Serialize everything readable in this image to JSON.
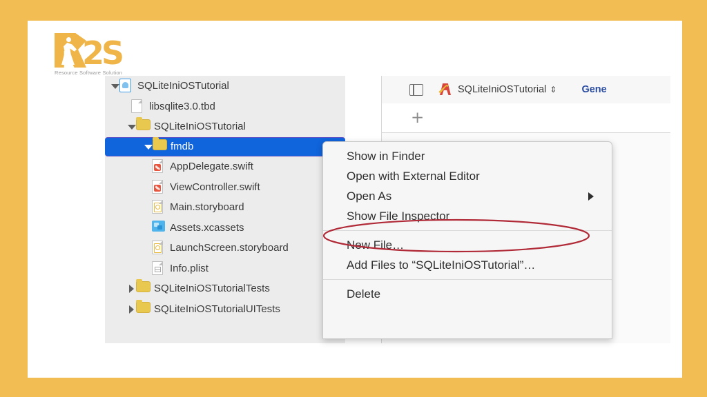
{
  "brand": {
    "logo_text": "R2S",
    "logo_letter_r": "R",
    "logo_letter_2": "2",
    "logo_letter_s": "S",
    "tagline": "Resource Software Solution",
    "accent_color": "#EFB548",
    "frame_color": "#F2BD52"
  },
  "xcode": {
    "scheme_name": "SQLiteIniOSTutorial",
    "scheme_chevrons": "⇕",
    "tab_general": "Gene",
    "add_button": "+",
    "app_icon_name": "xcode-project-icon",
    "sidebar_toggle_name": "sidebar-toggle-icon"
  },
  "navigator": {
    "selection_color": "#1064DC",
    "background_color": "#ECECEC",
    "rows": [
      {
        "label": "SQLiteIniOSTutorial",
        "icon": "project-file-icon",
        "indent": "ind0",
        "twisty": "down",
        "selected": false
      },
      {
        "label": "libsqlite3.0.tbd",
        "icon": "blank-page-icon",
        "indent": "ind1",
        "twisty": "none",
        "selected": false
      },
      {
        "label": "SQLiteIniOSTutorial",
        "icon": "folder-icon",
        "indent": "ind2",
        "twisty": "down",
        "selected": false
      },
      {
        "label": "fmdb",
        "icon": "folder-icon",
        "indent": "ind3",
        "twisty": "down",
        "selected": true
      },
      {
        "label": "AppDelegate.swift",
        "icon": "swift-file-icon",
        "indent": "ind4",
        "twisty": "none",
        "selected": false
      },
      {
        "label": "ViewController.swift",
        "icon": "swift-file-icon",
        "indent": "ind4",
        "twisty": "none",
        "selected": false
      },
      {
        "label": "Main.storyboard",
        "icon": "storyboard-file-icon",
        "indent": "ind4",
        "twisty": "none",
        "selected": false
      },
      {
        "label": "Assets.xcassets",
        "icon": "assets-catalog-icon",
        "indent": "ind4",
        "twisty": "none",
        "selected": false
      },
      {
        "label": "LaunchScreen.storyboard",
        "icon": "storyboard-file-icon",
        "indent": "ind4",
        "twisty": "none",
        "selected": false
      },
      {
        "label": "Info.plist",
        "icon": "plist-file-icon",
        "indent": "ind4",
        "twisty": "none",
        "selected": false
      },
      {
        "label": "SQLiteIniOSTutorialTests",
        "icon": "folder-icon",
        "indent": "ind2",
        "twisty": "right",
        "selected": false
      },
      {
        "label": "SQLiteIniOSTutorialUITests",
        "icon": "folder-icon",
        "indent": "ind2",
        "twisty": "right",
        "selected": false
      }
    ]
  },
  "context_menu": {
    "groups": [
      {
        "items": [
          {
            "label": "Show in Finder",
            "submenu": false
          },
          {
            "label": "Open with External Editor",
            "submenu": false
          },
          {
            "label": "Open As",
            "submenu": true
          },
          {
            "label": "Show File Inspector",
            "submenu": false
          }
        ]
      },
      {
        "items": [
          {
            "label": "New File…",
            "submenu": false
          },
          {
            "label": "Add Files to “SQLiteIniOSTutorial”…",
            "submenu": false
          }
        ]
      },
      {
        "items": [
          {
            "label": "Delete",
            "submenu": false
          }
        ]
      }
    ]
  },
  "annotation": {
    "shape": "ellipse",
    "color": "#B02A37",
    "targets_label": "Add Files to “SQLiteIniOSTutorial”…"
  }
}
